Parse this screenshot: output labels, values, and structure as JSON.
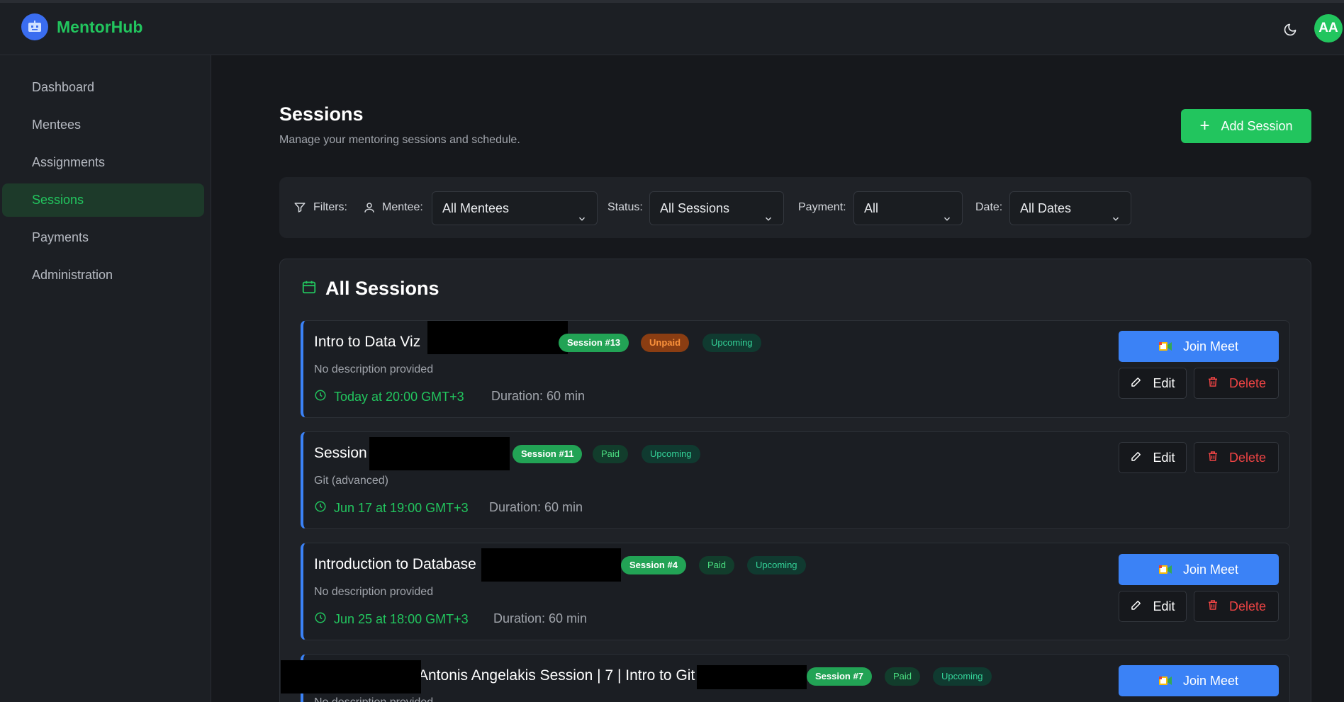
{
  "app": {
    "brand": "MentorHub",
    "avatar_initials": "AA"
  },
  "icons": {
    "theme": "moon-icon",
    "logo": "robot-logo-icon"
  },
  "sidebar": {
    "items": [
      {
        "label": "Dashboard",
        "active": false
      },
      {
        "label": "Mentees",
        "active": false
      },
      {
        "label": "Assignments",
        "active": false
      },
      {
        "label": "Sessions",
        "active": true
      },
      {
        "label": "Payments",
        "active": false
      },
      {
        "label": "Administration",
        "active": false
      }
    ]
  },
  "page": {
    "title": "Sessions",
    "subtitle": "Manage your mentoring sessions and schedule.",
    "add_button": "Add Session"
  },
  "filters": {
    "label": "Filters:",
    "mentee_label": "Mentee:",
    "mentee_value": "All Mentees",
    "status_label": "Status:",
    "status_value": "All Sessions",
    "payment_label": "Payment:",
    "payment_value": "All",
    "date_label": "Date:",
    "date_value": "All Dates"
  },
  "sessions_panel": {
    "title": "All Sessions",
    "join_label": "Join Meet",
    "edit_label": "Edit",
    "delete_label": "Delete",
    "duration_prefix": "Duration:",
    "cards": [
      {
        "title": "Intro to Data Viz",
        "session_no": "Session #13",
        "payment": "Unpaid",
        "status": "Upcoming",
        "description": "No description provided",
        "time": "Today at 20:00 GMT+3",
        "duration": "Duration: 60 min",
        "has_join": true
      },
      {
        "title": "Session",
        "session_no": "Session #11",
        "payment": "Paid",
        "status": "Upcoming",
        "description": "Git (advanced)",
        "time": "Jun 17 at 19:00 GMT+3",
        "duration": "Duration: 60 min",
        "has_join": false
      },
      {
        "title": "Introduction to Database",
        "session_no": "Session #4",
        "payment": "Paid",
        "status": "Upcoming",
        "description": "No description provided",
        "time": "Jun 25 at 18:00 GMT+3",
        "duration": "Duration: 60 min",
        "has_join": true
      },
      {
        "title": "Antonis Angelakis Session | 7 | Intro to Git",
        "session_no": "Session #7",
        "payment": "Paid",
        "status": "Upcoming",
        "description": "No description provided",
        "has_join": true
      }
    ]
  },
  "colors": {
    "accent_green": "#22c55e",
    "primary_blue": "#3b82f6",
    "danger_red": "#ef4444",
    "background": "#16181c"
  }
}
